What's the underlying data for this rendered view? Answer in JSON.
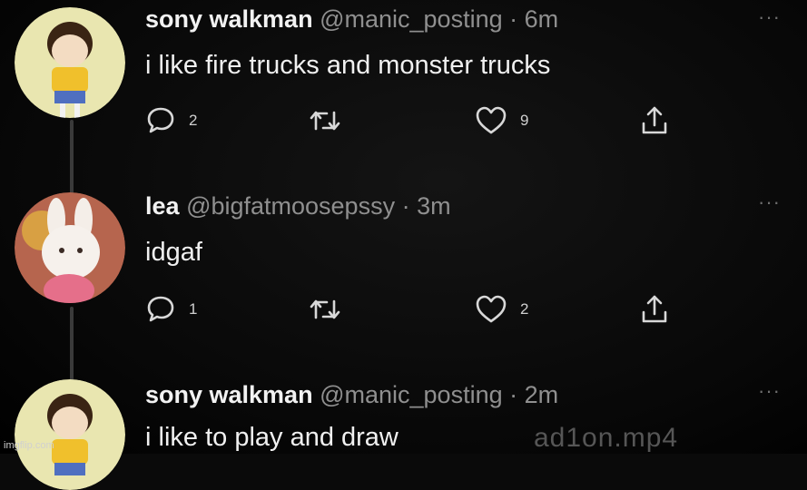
{
  "tweets": [
    {
      "name": "sony walkman",
      "handle": "@manic_posting",
      "time": "· 6m",
      "text": "i like fire trucks and monster trucks",
      "reply_count": "2",
      "retweet_count": "",
      "like_count": "9",
      "more": "···"
    },
    {
      "name": "lea",
      "handle": "@bigfatmoosepssy",
      "time": "· 3m",
      "text": "idgaf",
      "reply_count": "1",
      "retweet_count": "",
      "like_count": "2",
      "more": "···"
    },
    {
      "name": "sony walkman",
      "handle": "@manic_posting",
      "time": "· 2m",
      "text": "i like to play and draw",
      "more": "···"
    }
  ],
  "watermark": "ad1on.mp4",
  "imgflip": "imgflip.com",
  "colors": {
    "background": "#0a0a0a",
    "name": "#f2f2f2",
    "handle": "#8f8f8f",
    "icon": "#d8d8d8"
  },
  "icons": [
    "reply-icon",
    "retweet-icon",
    "like-icon",
    "share-icon",
    "more-icon"
  ]
}
